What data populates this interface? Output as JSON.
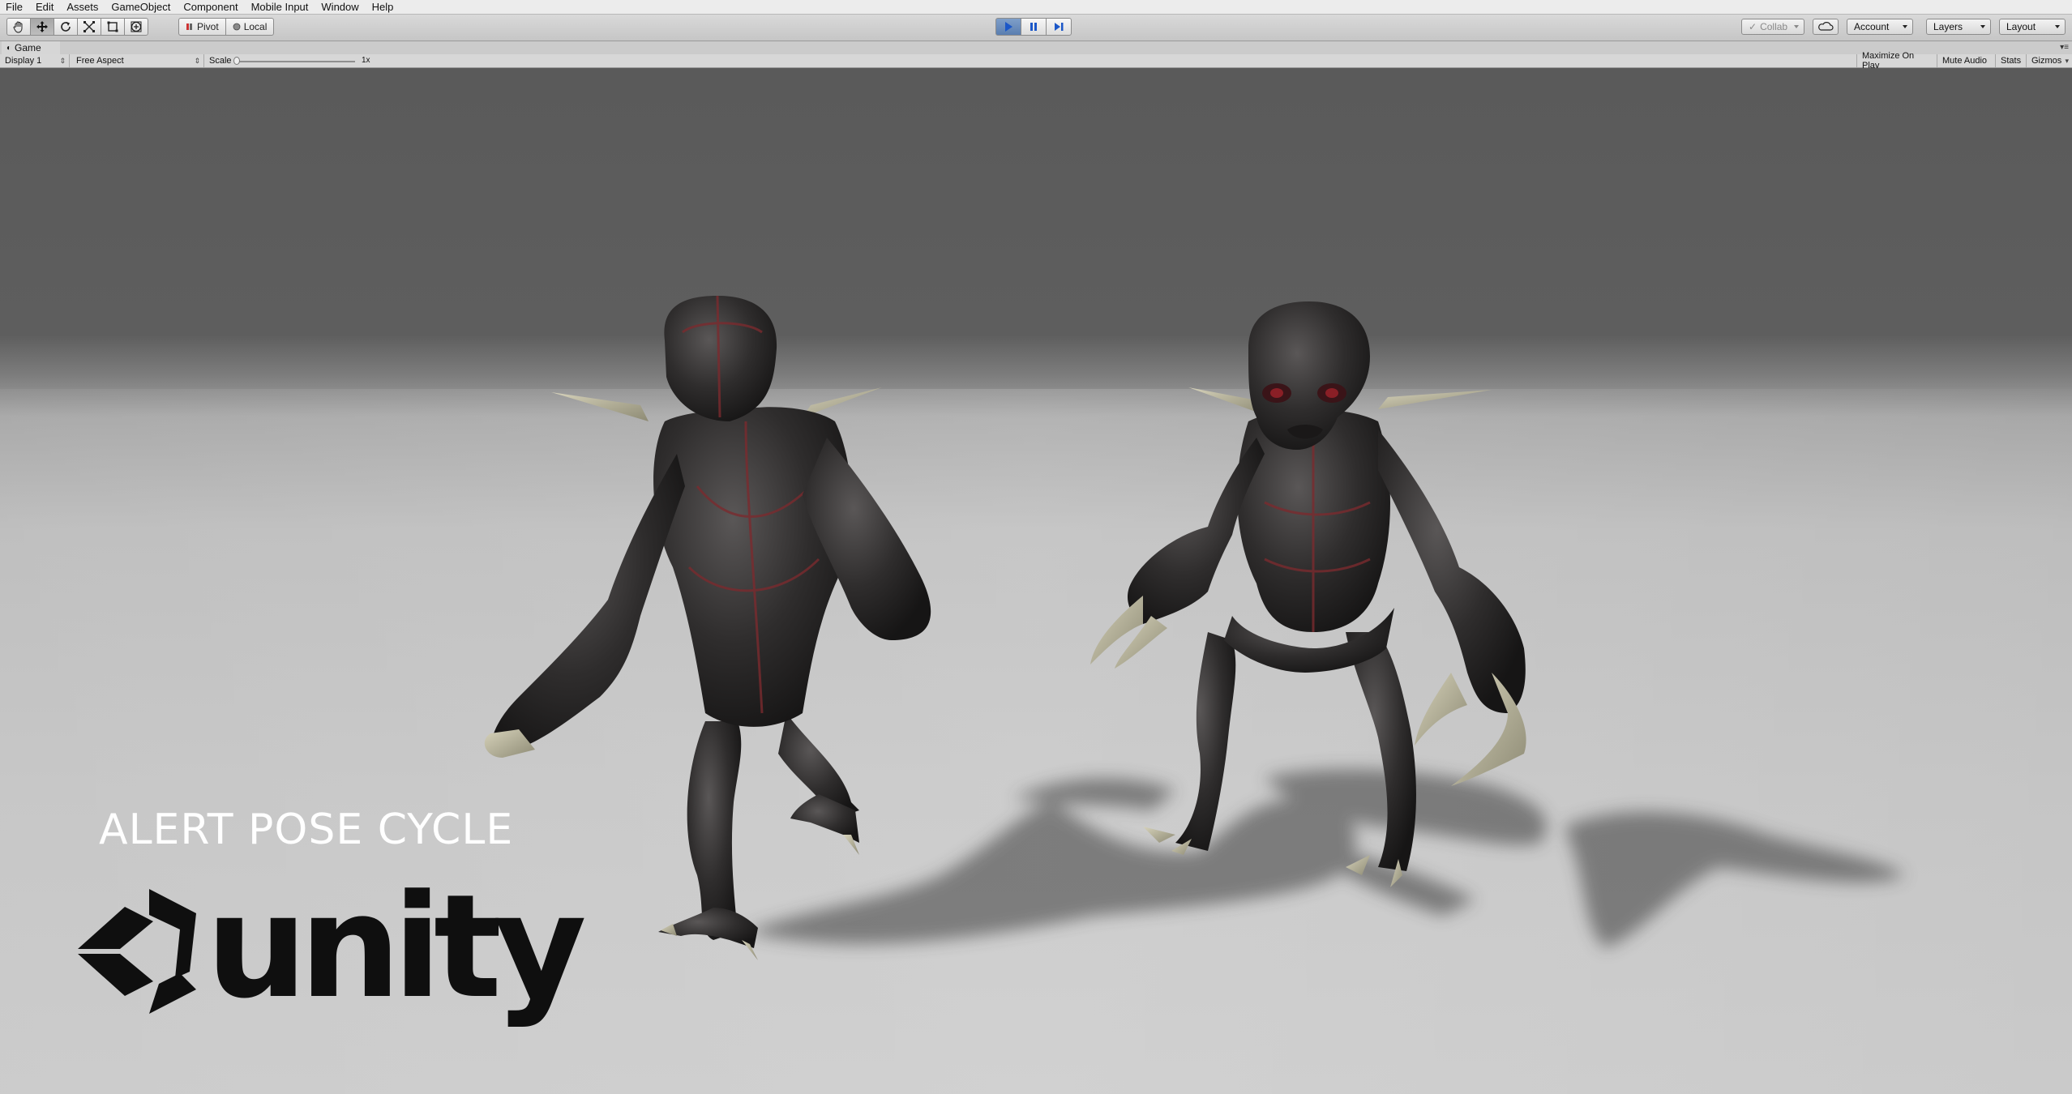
{
  "menu": {
    "items": [
      "File",
      "Edit",
      "Assets",
      "GameObject",
      "Component",
      "Mobile Input",
      "Window",
      "Help"
    ]
  },
  "toolbar": {
    "tools": [
      "hand-tool",
      "move-tool",
      "rotate-tool",
      "scale-tool",
      "rect-tool",
      "transform-tool"
    ],
    "pivot_label": "Pivot",
    "local_label": "Local",
    "collab_label": "Collab",
    "account_label": "Account",
    "layers_label": "Layers",
    "layout_label": "Layout"
  },
  "game_tab": {
    "tab_label": "Game",
    "display": "Display 1",
    "aspect": "Free Aspect",
    "scale_label": "Scale",
    "scale_value": "1x",
    "maximize": "Maximize On Play",
    "mute": "Mute Audio",
    "stats": "Stats",
    "gizmos": "Gizmos"
  },
  "scene": {
    "overlay_title": "ALERT POSE CYCLE",
    "logo_text": "unity",
    "colors": {
      "backdrop_top": "#5a5a5a",
      "floor": "#c4c4c4",
      "creature_skin": "#2e2c2c",
      "creature_seams": "#7a2a2e",
      "claws": "#b9b59c"
    }
  }
}
